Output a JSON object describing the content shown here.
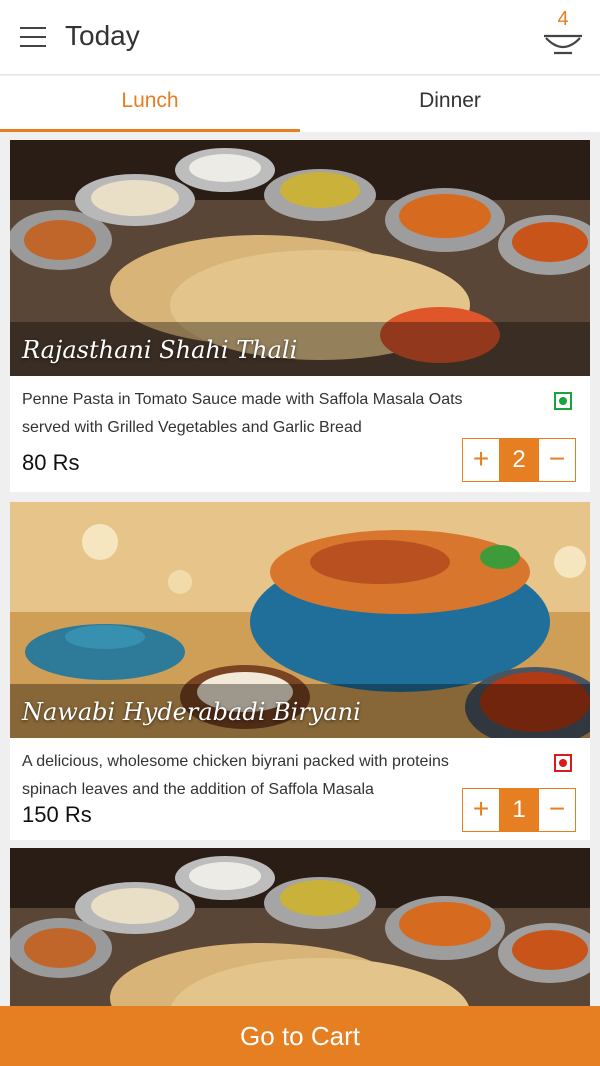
{
  "header": {
    "title": "Today",
    "cart_count": "4",
    "menu_icon": "hamburger-menu-icon",
    "cart_icon": "bowl-icon"
  },
  "tabs": [
    {
      "label": "Lunch",
      "active": true
    },
    {
      "label": "Dinner",
      "active": false
    }
  ],
  "items": [
    {
      "name": "Rajasthani Shahi Thali",
      "description": "Penne Pasta in Tomato Sauce made with Saffola Masala Oats served with Grilled Vegetables and Garlic Bread",
      "price": "80 Rs",
      "quantity": "2",
      "veg": true
    },
    {
      "name": "Nawabi Hyderabadi Biryani",
      "description": "A delicious, wholesome chicken biyrani packed with proteins spinach leaves and the addition of Saffola Masala",
      "price": "150 Rs",
      "quantity": "1",
      "veg": false
    },
    {
      "name": "",
      "veg": true
    }
  ],
  "stepper": {
    "plus": "+",
    "minus": "−"
  },
  "footer": {
    "cart_button": "Go to Cart"
  },
  "colors": {
    "accent": "#e67e22",
    "veg": "#1aa53a",
    "nonveg": "#d81b1b"
  }
}
